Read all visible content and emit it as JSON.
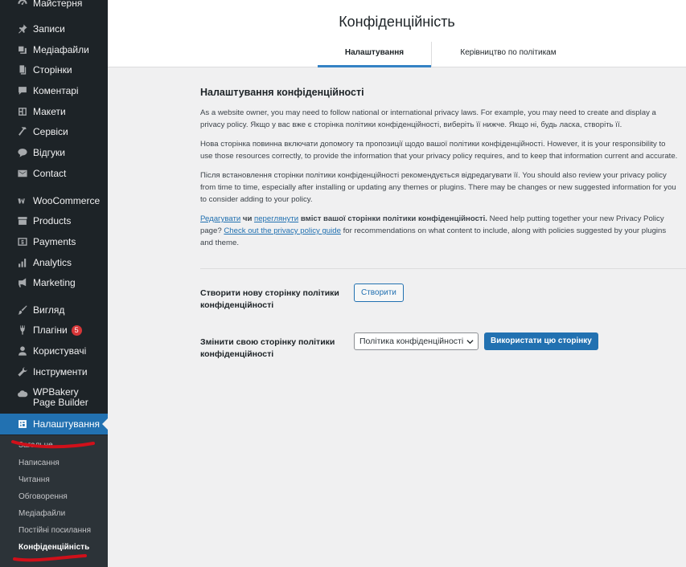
{
  "sidebar": {
    "items": [
      {
        "label": "Майстерня",
        "icon": "dashboard-icon"
      },
      {
        "label": "Записи",
        "icon": "pin-icon"
      },
      {
        "label": "Медіафайли",
        "icon": "media-icon"
      },
      {
        "label": "Сторінки",
        "icon": "pages-icon"
      },
      {
        "label": "Коментарі",
        "icon": "comment-icon"
      },
      {
        "label": "Макети",
        "icon": "layout-icon"
      },
      {
        "label": "Сервіси",
        "icon": "hammer-icon"
      },
      {
        "label": "Відгуки",
        "icon": "feedback-icon"
      },
      {
        "label": "Contact",
        "icon": "mail-icon"
      },
      {
        "label": "WooCommerce",
        "icon": "woo-icon"
      },
      {
        "label": "Products",
        "icon": "archive-icon"
      },
      {
        "label": "Payments",
        "icon": "payment-icon"
      },
      {
        "label": "Analytics",
        "icon": "bar-chart-icon"
      },
      {
        "label": "Marketing",
        "icon": "megaphone-icon"
      },
      {
        "label": "Вигляд",
        "icon": "brush-icon"
      },
      {
        "label": "Плагіни",
        "icon": "plugin-icon",
        "badge": "5"
      },
      {
        "label": "Користувачі",
        "icon": "user-icon"
      },
      {
        "label": "Інструменти",
        "icon": "wrench-icon"
      },
      {
        "label": "WPBakery Page Builder",
        "icon": "cloud-icon"
      },
      {
        "label": "Налаштування",
        "icon": "settings-icon"
      }
    ],
    "submenu": [
      "Загальне",
      "Написання",
      "Читання",
      "Обговорення",
      "Медіафайли",
      "Постійні посилання",
      "Конфіденційність"
    ]
  },
  "header": {
    "title": "Конфіденційність",
    "tabs": [
      "Налаштування",
      "Керівництво по політикам"
    ]
  },
  "main": {
    "heading": "Налаштування конфіденційності",
    "p1": "As a website owner, you may need to follow national or international privacy laws. For example, you may need to create and display a privacy policy. Якщо у вас вже є сторінка політики конфіденційності, виберіть її нижче. Якщо ні, будь ласка, створіть її.",
    "p2": "Нова сторінка повинна включати допомогу та пропозиції щодо вашої політики конфіденційності. However, it is your responsibility to use those resources correctly, to provide the information that your privacy policy requires, and to keep that information current and accurate.",
    "p3": "Після встановлення сторінки політики конфіденційності рекомендується відредагувати її. You should also review your privacy policy from time to time, especially after installing or updating any themes or plugins. There may be changes or new suggested information for you to consider adding to your policy.",
    "p4": {
      "edit_link": "Редагувати",
      "or": " чи ",
      "view_link": "переглянути",
      "strong": " вміст вашої сторінки політики конфіденційності.",
      "mid": " Need help putting together your new Privacy Policy page? ",
      "guide_link": "Check out the privacy policy guide",
      "tail": " for recommendations on what content to include, along with policies suggested by your plugins and theme."
    },
    "create_label": "Створити нову сторінку політики конфіденційності",
    "create_button": "Створити",
    "change_label": "Змінити свою сторінку політики конфіденційності",
    "select_value": "Політика конфіденційності",
    "use_button": "Використати цю сторінку"
  },
  "colors": {
    "sidebar_bg": "#1d2327",
    "accent": "#2271b1",
    "badge": "#d63638",
    "annotation": "#d0101a"
  }
}
